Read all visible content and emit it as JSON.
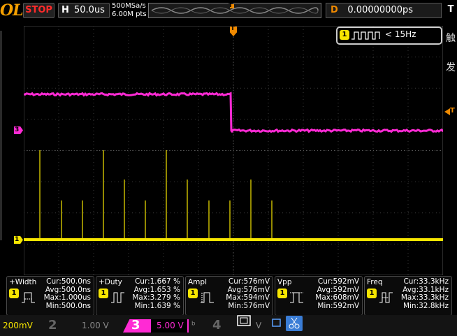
{
  "top": {
    "brand": "OL",
    "run_state": "STOP",
    "horizontal_letter": "H",
    "timebase": "50.0us",
    "sample_rate": "500MSa/s",
    "memory_depth": "6.00M pts",
    "trig_letter": "T",
    "delay_letter": "D",
    "delay_value": "0.00000000ps",
    "trigger_mode_letter": "T"
  },
  "side_panel": {
    "char1": "触",
    "char2": "发"
  },
  "frequency_badge": {
    "channel": "1",
    "text": "< 15Hz"
  },
  "markers": {
    "ch3": "3",
    "ch1": "1",
    "trigger": "T"
  },
  "colors": {
    "ch1": "#f7e600",
    "ch3": "#ff2ad4",
    "accent": "#f08a00",
    "run": "#ff2a2a"
  },
  "measurements": [
    {
      "title": "+Width",
      "channel": "1",
      "icon": "pulse-width-icon",
      "cur": "Cur:500.0ns",
      "avg": "Avg:500.0ns",
      "max": "Max:1.000us",
      "min": "Min:500.0ns"
    },
    {
      "title": "+Duty",
      "channel": "1",
      "icon": "duty-icon",
      "cur": "Cur:1.667 %",
      "avg": "Avg:1.653 %",
      "max": "Max:3.279 %",
      "min": "Min:1.639 %"
    },
    {
      "title": "Ampl",
      "channel": "1",
      "icon": "amplitude-icon",
      "cur": "Cur:576mV",
      "avg": "Avg:576mV",
      "max": "Max:594mV",
      "min": "Min:576mV"
    },
    {
      "title": "Vpp",
      "channel": "1",
      "icon": "vpp-icon",
      "cur": "Cur:592mV",
      "avg": "Avg:592mV",
      "max": "Max:608mV",
      "min": "Min:592mV"
    },
    {
      "title": "Freq",
      "channel": "1",
      "icon": "frequency-icon",
      "cur": "Cur:33.3kHz",
      "avg": "Avg:33.1kHz",
      "max": "Max:33.3kHz",
      "min": "Min:32.8kHz"
    }
  ],
  "channels": [
    {
      "num": "",
      "scale": "200mV"
    },
    {
      "num": "2",
      "scale": "1.00 V"
    },
    {
      "num": "3",
      "scale": "5.00 V"
    },
    {
      "num": "4",
      "scale": "V"
    }
  ]
}
